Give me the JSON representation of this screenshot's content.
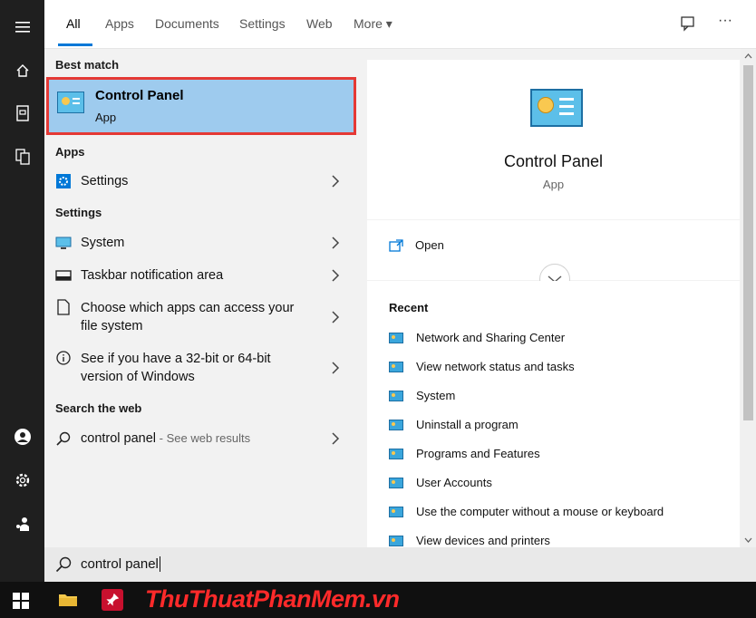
{
  "tabs": {
    "items": [
      "All",
      "Apps",
      "Documents",
      "Settings",
      "Web",
      "More"
    ],
    "more_arrow": "▾",
    "feedback_icon": "feedback-icon",
    "options": "···"
  },
  "left": {
    "best_match_heading": "Best match",
    "best_match": {
      "title": "Control Panel",
      "subtitle": "App"
    },
    "apps_heading": "Apps",
    "apps": [
      {
        "label": "Settings"
      }
    ],
    "settings_heading": "Settings",
    "settings": [
      {
        "label": "System"
      },
      {
        "label": "Taskbar notification area"
      },
      {
        "label": "Choose which apps can access your",
        "label2": "file system"
      },
      {
        "label": "See if you have a 32-bit or 64-bit",
        "label2": "version of Windows"
      }
    ],
    "web_heading": "Search the web",
    "web": {
      "query": "control panel",
      "hint": " - See web results"
    }
  },
  "right": {
    "title": "Control Panel",
    "subtitle": "App",
    "open_label": "Open",
    "recent_heading": "Recent",
    "recent": [
      "Network and Sharing Center",
      "View network status and tasks",
      "System",
      "Uninstall a program",
      "Programs and Features",
      "User Accounts",
      "Use the computer without a mouse or keyboard",
      "View devices and printers"
    ]
  },
  "search": {
    "value": "control panel"
  },
  "watermark": {
    "part1": "Thu",
    "part2": "Thuat",
    "part3": "Phan",
    "part4": "Mem",
    "part5": ".vn"
  },
  "colors": {
    "accent": "#0078d7",
    "highlight": "#9ecbee",
    "outline": "#e53935"
  }
}
